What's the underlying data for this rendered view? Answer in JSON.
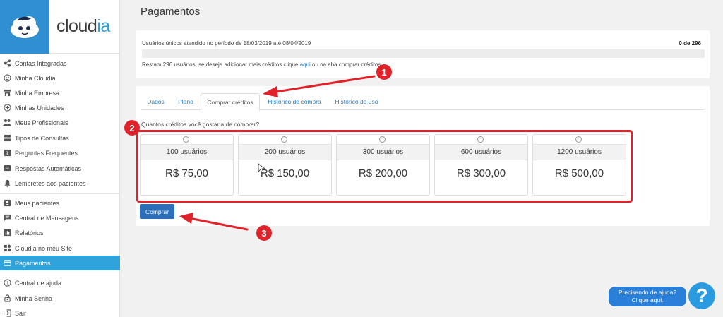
{
  "brand": {
    "name_part1": "cloud",
    "name_part2": "ia"
  },
  "sidebar": {
    "group1": [
      {
        "label": "Contas Integradas",
        "icon": "share-icon"
      },
      {
        "label": "Minha Cloudia",
        "icon": "face-icon"
      },
      {
        "label": "Minha Empresa",
        "icon": "store-icon"
      },
      {
        "label": "Minhas Unidades",
        "icon": "plus-circle-icon"
      },
      {
        "label": "Meus Profissionais",
        "icon": "people-icon"
      },
      {
        "label": "Tipos de Consultas",
        "icon": "list-icon"
      },
      {
        "label": "Perguntas Frequentes",
        "icon": "help-box-icon"
      },
      {
        "label": "Respostas Automáticas",
        "icon": "message-icon"
      },
      {
        "label": "Lembretes aos pacientes",
        "icon": "bell-icon"
      }
    ],
    "group2": [
      {
        "label": "Meus pacientes",
        "icon": "contact-icon"
      },
      {
        "label": "Central de Mensagens",
        "icon": "chat-icon"
      },
      {
        "label": "Relatórios",
        "icon": "chart-icon"
      },
      {
        "label": "Cloudia no meu Site",
        "icon": "widgets-icon"
      },
      {
        "label": "Pagamentos",
        "icon": "card-icon",
        "active": true
      }
    ],
    "group3": [
      {
        "label": "Central de ajuda",
        "icon": "question-circle-icon"
      },
      {
        "label": "Minha Senha",
        "icon": "lock-icon"
      },
      {
        "label": "Sair",
        "icon": "exit-icon"
      }
    ]
  },
  "page": {
    "title": "Pagamentos"
  },
  "usage": {
    "period_text": "Usuários únicos atendido no período de 18/03/2019 até 08/04/2019",
    "count": "0 de 296",
    "progress": 0,
    "remaining_prefix": "Restam 296 usuários, se deseja adicionar mais créditos clique ",
    "remaining_link": "aqui",
    "remaining_suffix": " ou na aba comprar créditos."
  },
  "tabs": [
    {
      "label": "Dados"
    },
    {
      "label": "Plano"
    },
    {
      "label": "Comprar créditos",
      "active": true
    },
    {
      "label": "Histórico de compra"
    },
    {
      "label": "Histórico de uso"
    }
  ],
  "purchase": {
    "question": "Quantos créditos você gostaria de comprar?",
    "options": [
      {
        "users": "100 usuários",
        "price": "R$ 75,00"
      },
      {
        "users": "200 usuários",
        "price": "R$ 150,00"
      },
      {
        "users": "300 usuários",
        "price": "R$ 200,00"
      },
      {
        "users": "600 usuários",
        "price": "R$ 300,00"
      },
      {
        "users": "1200 usuários",
        "price": "R$ 500,00"
      }
    ],
    "button_label": "Comprar"
  },
  "annotations": {
    "step1": "1",
    "step2": "2",
    "step3": "3",
    "color": "#e0222a"
  },
  "help": {
    "line1": "Precisando de ajuda?",
    "line2": "Clique aqui.",
    "icon_glyph": "?"
  }
}
